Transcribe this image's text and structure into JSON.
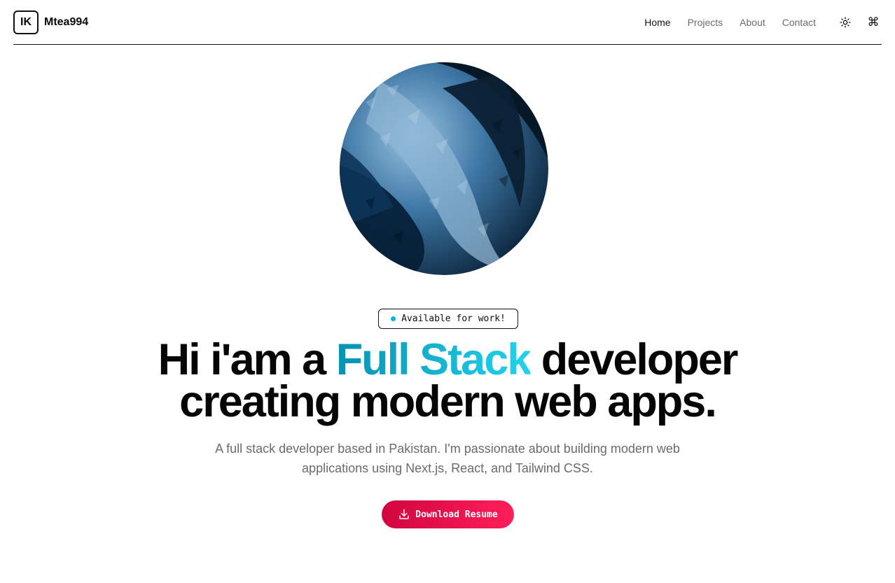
{
  "header": {
    "logo_initials": "IK",
    "brand_name": "Mtea994",
    "nav": [
      {
        "label": "Home",
        "active": true
      },
      {
        "label": "Projects",
        "active": false
      },
      {
        "label": "About",
        "active": false
      },
      {
        "label": "Contact",
        "active": false
      }
    ],
    "theme_icon": "sun-icon",
    "command_icon": "command-icon",
    "command_glyph": "⌘"
  },
  "hero": {
    "sphere_image": "blue-polygonal-sphere",
    "badge_text": "Available for work!",
    "badge_dot_color": "#06b6d4",
    "headline_prefix": "Hi i'am a ",
    "headline_highlight": "Full Stack",
    "headline_suffix_line1": " developer",
    "headline_line2": "creating modern web apps.",
    "subtitle": "A full stack developer based in Pakistan. I'm passionate about building modern web applications using Next.js, React, and Tailwind CSS.",
    "cta_label": "Download Resume",
    "cta_icon": "download-icon"
  },
  "colors": {
    "accent_gradient_start": "#0891b2",
    "accent_gradient_end": "#22d3ee",
    "button_gradient_start": "#d1043f",
    "button_gradient_end": "#ff1f5a"
  }
}
